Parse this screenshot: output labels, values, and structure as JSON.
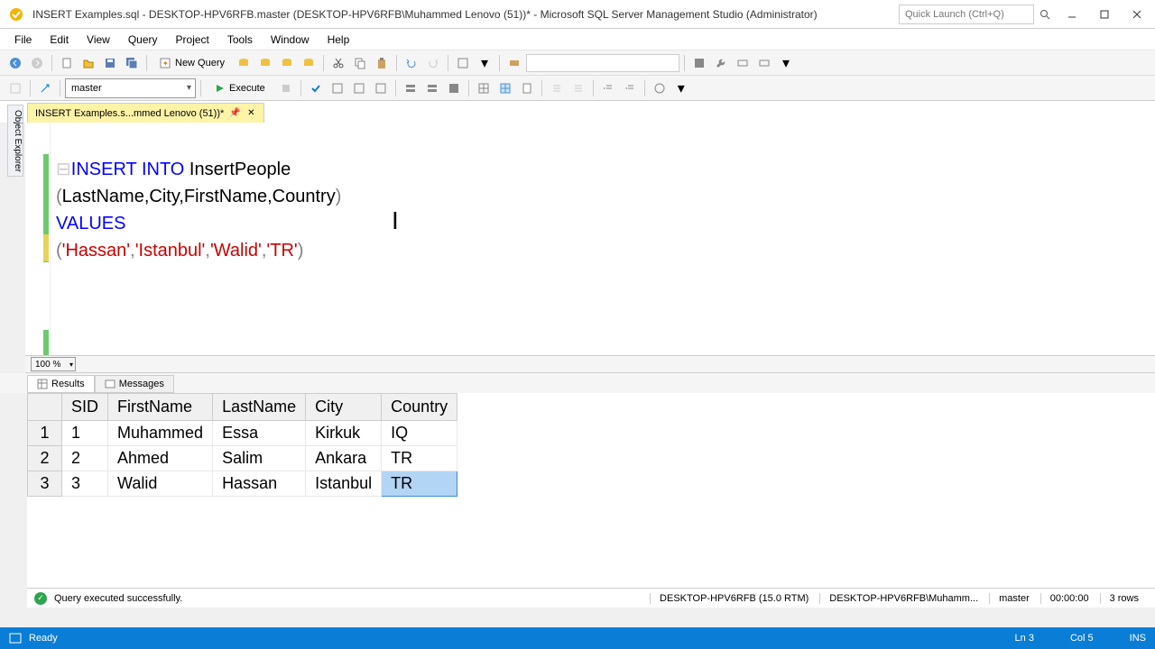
{
  "window": {
    "title": "INSERT Examples.sql - DESKTOP-HPV6RFB.master (DESKTOP-HPV6RFB\\Muhammed Lenovo (51))* - Microsoft SQL Server Management Studio (Administrator)",
    "quick_launch_placeholder": "Quick Launch (Ctrl+Q)"
  },
  "menu": {
    "file": "File",
    "edit": "Edit",
    "view": "View",
    "query": "Query",
    "project": "Project",
    "tools": "Tools",
    "window": "Window",
    "help": "Help"
  },
  "toolbar": {
    "new_query": "New Query",
    "database": "master",
    "execute": "Execute"
  },
  "object_explorer_label": "Object Explorer",
  "tab": {
    "title": "INSERT Examples.s...mmed Lenovo (51))*"
  },
  "sql": {
    "insert_into": "INSERT INTO",
    "table": " InsertPeople",
    "cols_open": "(",
    "cols": "LastName,City,FirstName,Country",
    "cols_close": ")",
    "values_kw": "VALUES",
    "vals_open": "(",
    "v1": "'Hassan'",
    "c1": ",",
    "v2": "'Istanbul'",
    "c2": ",",
    "v3": "'Walid'",
    "c3": ",",
    "v4": "'TR'",
    "vals_close": ")"
  },
  "zoom": "100 %",
  "results_tabs": {
    "results": "Results",
    "messages": "Messages"
  },
  "grid": {
    "headers": [
      "",
      "SID",
      "FirstName",
      "LastName",
      "City",
      "Country"
    ],
    "rows": [
      {
        "n": "1",
        "sid": "1",
        "first": "Muhammed",
        "last": "Essa",
        "city": "Kirkuk",
        "country": "IQ"
      },
      {
        "n": "2",
        "sid": "2",
        "first": "Ahmed",
        "last": "Salim",
        "city": "Ankara",
        "country": "TR"
      },
      {
        "n": "3",
        "sid": "3",
        "first": "Walid",
        "last": "Hassan",
        "city": "Istanbul",
        "country": "TR"
      }
    ]
  },
  "query_status": {
    "message": "Query executed successfully.",
    "server": "DESKTOP-HPV6RFB (15.0 RTM)",
    "user": "DESKTOP-HPV6RFB\\Muhamm...",
    "db": "master",
    "time": "00:00:00",
    "rows": "3 rows"
  },
  "ide_status": {
    "ready": "Ready",
    "ln": "Ln 3",
    "col": "Col 5",
    "ins": "INS"
  }
}
